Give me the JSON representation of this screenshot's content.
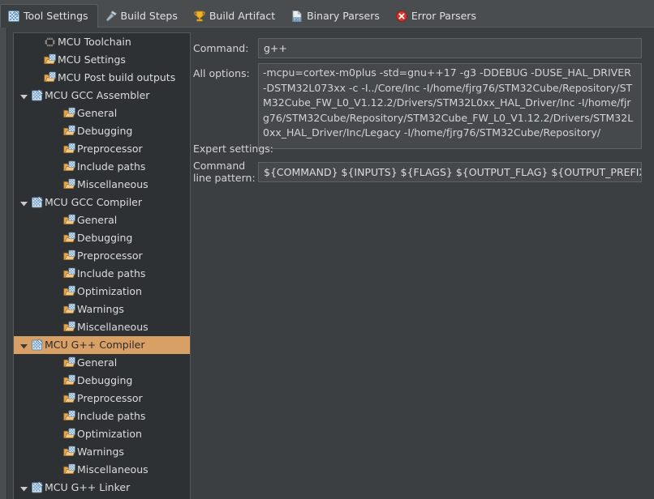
{
  "window": {
    "title": "Tool Settings"
  },
  "tabs": [
    {
      "label": "Tool Settings",
      "icon": "tool-settings-icon",
      "active": true
    },
    {
      "label": "Build Steps",
      "icon": "build-steps-icon",
      "active": false
    },
    {
      "label": "Build Artifact",
      "icon": "build-artifact-icon",
      "active": false
    },
    {
      "label": "Binary Parsers",
      "icon": "binary-parsers-icon",
      "active": false
    },
    {
      "label": "Error Parsers",
      "icon": "error-parsers-icon",
      "active": false
    }
  ],
  "tree": {
    "selected": "MCU G++ Compiler",
    "items": [
      {
        "label": "MCU Toolchain",
        "level": 1,
        "icon": "chip-icon",
        "twisty": "none"
      },
      {
        "label": "MCU Settings",
        "level": 1,
        "icon": "folder-icon",
        "twisty": "none"
      },
      {
        "label": "MCU Post build outputs",
        "level": 1,
        "icon": "folder-icon",
        "twisty": "none"
      },
      {
        "label": "MCU GCC Assembler",
        "level": 0,
        "icon": "tool-icon",
        "twisty": "expanded"
      },
      {
        "label": "General",
        "level": 2,
        "icon": "folder-icon",
        "twisty": "none"
      },
      {
        "label": "Debugging",
        "level": 2,
        "icon": "folder-icon",
        "twisty": "none"
      },
      {
        "label": "Preprocessor",
        "level": 2,
        "icon": "folder-icon",
        "twisty": "none"
      },
      {
        "label": "Include paths",
        "level": 2,
        "icon": "folder-icon",
        "twisty": "none"
      },
      {
        "label": "Miscellaneous",
        "level": 2,
        "icon": "folder-icon",
        "twisty": "none"
      },
      {
        "label": "MCU GCC Compiler",
        "level": 0,
        "icon": "tool-icon",
        "twisty": "expanded"
      },
      {
        "label": "General",
        "level": 2,
        "icon": "folder-icon",
        "twisty": "none"
      },
      {
        "label": "Debugging",
        "level": 2,
        "icon": "folder-icon",
        "twisty": "none"
      },
      {
        "label": "Preprocessor",
        "level": 2,
        "icon": "folder-icon",
        "twisty": "none"
      },
      {
        "label": "Include paths",
        "level": 2,
        "icon": "folder-icon",
        "twisty": "none"
      },
      {
        "label": "Optimization",
        "level": 2,
        "icon": "folder-icon",
        "twisty": "none"
      },
      {
        "label": "Warnings",
        "level": 2,
        "icon": "folder-icon",
        "twisty": "none"
      },
      {
        "label": "Miscellaneous",
        "level": 2,
        "icon": "folder-icon",
        "twisty": "none"
      },
      {
        "label": "MCU G++ Compiler",
        "level": 0,
        "icon": "tool-icon",
        "twisty": "expanded",
        "selected": true
      },
      {
        "label": "General",
        "level": 2,
        "icon": "folder-icon",
        "twisty": "none"
      },
      {
        "label": "Debugging",
        "level": 2,
        "icon": "folder-icon",
        "twisty": "none"
      },
      {
        "label": "Preprocessor",
        "level": 2,
        "icon": "folder-icon",
        "twisty": "none"
      },
      {
        "label": "Include paths",
        "level": 2,
        "icon": "folder-icon",
        "twisty": "none"
      },
      {
        "label": "Optimization",
        "level": 2,
        "icon": "folder-icon",
        "twisty": "none"
      },
      {
        "label": "Warnings",
        "level": 2,
        "icon": "folder-icon",
        "twisty": "none"
      },
      {
        "label": "Miscellaneous",
        "level": 2,
        "icon": "folder-icon",
        "twisty": "none"
      },
      {
        "label": "MCU G++ Linker",
        "level": 0,
        "icon": "tool-icon",
        "twisty": "expanded"
      }
    ]
  },
  "form": {
    "command_label": "Command:",
    "command_value": "g++",
    "options_label": "All options:",
    "options_value": "-mcpu=cortex-m0plus -std=gnu++17 -g3 -DDEBUG -DUSE_HAL_DRIVER -DSTM32L073xx -c -I../Core/Inc -I/home/fjrg76/STM32Cube/Repository/STM32Cube_FW_L0_V1.12.2/Drivers/STM32L0xx_HAL_Driver/Inc -I/home/fjrg76/STM32Cube/Repository/STM32Cube_FW_L0_V1.12.2/Drivers/STM32L0xx_HAL_Driver/Inc/Legacy -I/home/fjrg76/STM32Cube/Repository/",
    "expert_label": "Expert settings:",
    "pattern_label_line1": "Command",
    "pattern_label_line2": "line pattern:",
    "pattern_value": "${COMMAND} ${INPUTS} ${FLAGS} ${OUTPUT_FLAG} ${OUTPUT_PREFIX}${OUTPUT} ${INPUTS}"
  },
  "colors": {
    "selection": "#d9a066",
    "panel_bg": "#3c3f41",
    "tree_bg": "#2e3133",
    "tabbar_bg": "#4a4d4f",
    "field_bg": "#46494b",
    "text": "#d6d6d6"
  }
}
